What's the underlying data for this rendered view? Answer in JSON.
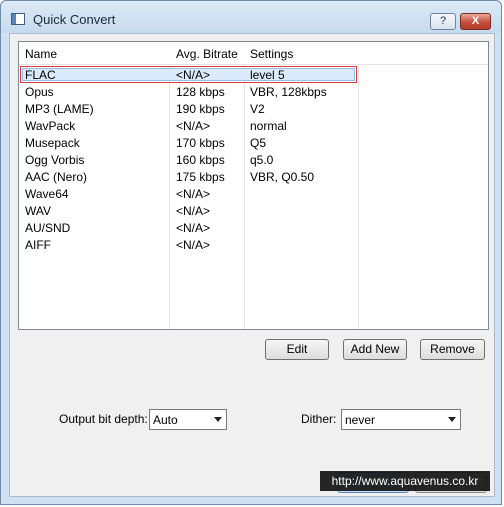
{
  "window": {
    "title": "Quick Convert",
    "help_label": "?",
    "close_label": "X"
  },
  "list": {
    "headers": {
      "name": "Name",
      "bitrate": "Avg. Bitrate",
      "settings": "Settings"
    },
    "rows": [
      {
        "name": "FLAC",
        "bitrate": "<N/A>",
        "settings": "level 5"
      },
      {
        "name": "Opus",
        "bitrate": "128 kbps",
        "settings": "VBR, 128kbps"
      },
      {
        "name": "MP3 (LAME)",
        "bitrate": "190 kbps",
        "settings": "V2"
      },
      {
        "name": "WavPack",
        "bitrate": "<N/A>",
        "settings": "normal"
      },
      {
        "name": "Musepack",
        "bitrate": "170 kbps",
        "settings": "Q5"
      },
      {
        "name": "Ogg Vorbis",
        "bitrate": "160 kbps",
        "settings": "q5.0"
      },
      {
        "name": "AAC (Nero)",
        "bitrate": "175 kbps",
        "settings": "VBR, Q0.50"
      },
      {
        "name": "Wave64",
        "bitrate": "<N/A>",
        "settings": ""
      },
      {
        "name": "WAV",
        "bitrate": "<N/A>",
        "settings": ""
      },
      {
        "name": "AU/SND",
        "bitrate": "<N/A>",
        "settings": ""
      },
      {
        "name": "AIFF",
        "bitrate": "<N/A>",
        "settings": ""
      }
    ],
    "selected_index": 0
  },
  "buttons": {
    "edit": "Edit",
    "add_new": "Add New",
    "remove": "Remove"
  },
  "options": {
    "bit_depth_label": "Output bit depth:",
    "bit_depth_value": "Auto",
    "dither_label": "Dither:",
    "dither_value": "never"
  },
  "watermark": "http://www.aquavenus.co.kr"
}
